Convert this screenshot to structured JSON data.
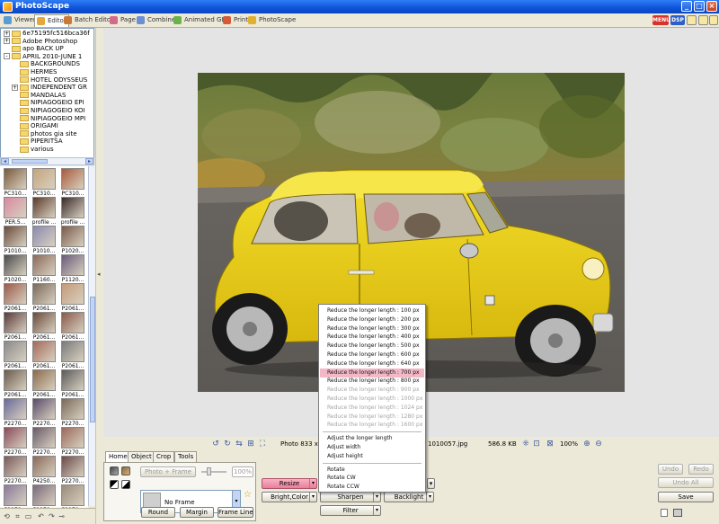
{
  "window": {
    "title": "PhotoScape",
    "controls": [
      "_",
      "□",
      "×"
    ]
  },
  "tabs": [
    {
      "label": "Viewer",
      "color": "#5a9bd4"
    },
    {
      "label": "Editor",
      "color": "#e3a83b"
    },
    {
      "label": "Batch Editor",
      "color": "#c97a3a"
    },
    {
      "label": "Page",
      "color": "#d46a8b"
    },
    {
      "label": "Combine",
      "color": "#6a8fd4"
    },
    {
      "label": "Animated GIF",
      "color": "#6ab34a"
    },
    {
      "label": "Print",
      "color": "#d45a3a"
    },
    {
      "label": "PhotoScape",
      "color": "#e0b030"
    }
  ],
  "toolbar_right": {
    "menu_label": "MENU",
    "menu_color": "#d9322a",
    "dsp_label": "DSP",
    "dsp_color": "#2d5fc9"
  },
  "tree": {
    "items": [
      {
        "label": "6e75195fc516bca36f",
        "indent": 0,
        "expand": "+"
      },
      {
        "label": "Adobe Photoshop",
        "indent": 0,
        "expand": "+"
      },
      {
        "label": "apo BACK UP",
        "indent": 0,
        "expand": ""
      },
      {
        "label": "APRIL 2010-JUNE 1",
        "indent": 0,
        "expand": "-"
      },
      {
        "label": "BACKGROUNDS",
        "indent": 1,
        "expand": ""
      },
      {
        "label": "HERMES",
        "indent": 1,
        "expand": ""
      },
      {
        "label": "HOTEL ODYSSEUS",
        "indent": 1,
        "expand": ""
      },
      {
        "label": "INDEPENDENT GR",
        "indent": 1,
        "expand": "+"
      },
      {
        "label": "MANDALAS",
        "indent": 1,
        "expand": ""
      },
      {
        "label": "NIPIAGOGEIO EPI",
        "indent": 1,
        "expand": ""
      },
      {
        "label": "NIPIAGOGEIO KOI",
        "indent": 1,
        "expand": ""
      },
      {
        "label": "NIPIAGOGEIO MPI",
        "indent": 1,
        "expand": ""
      },
      {
        "label": "ORIGAMI",
        "indent": 1,
        "expand": ""
      },
      {
        "label": "photos gia site",
        "indent": 1,
        "expand": ""
      },
      {
        "label": "PIPERITSA",
        "indent": 1,
        "expand": ""
      },
      {
        "label": "various",
        "indent": 1,
        "expand": ""
      }
    ]
  },
  "thumbnails": [
    {
      "label": "PC310...",
      "color": "#7a5a3a"
    },
    {
      "label": "PC310...",
      "color": "#c4a47a"
    },
    {
      "label": "PC310...",
      "color": "#a85a3a"
    },
    {
      "label": "PER.5...",
      "color": "#d88aa0"
    },
    {
      "label": "profile ...",
      "color": "#5a3a2a"
    },
    {
      "label": "profile ...",
      "color": "#3a2a2a"
    },
    {
      "label": "P1010...",
      "color": "#6a4a3a"
    },
    {
      "label": "P1010...",
      "color": "#8a8ab0"
    },
    {
      "label": "P1020...",
      "color": "#7a5a4a"
    },
    {
      "label": "P1020...",
      "color": "#4a4a4a"
    },
    {
      "label": "P1160...",
      "color": "#8a6a5a"
    },
    {
      "label": "P1120...",
      "color": "#6a5a7a"
    },
    {
      "label": "P2061...",
      "color": "#9a5a4a"
    },
    {
      "label": "P2061...",
      "color": "#7a6a5a"
    },
    {
      "label": "P2061...",
      "color": "#c49a7a"
    },
    {
      "label": "P2061...",
      "color": "#5a3a3a"
    },
    {
      "label": "P2061...",
      "color": "#6a4a3a"
    },
    {
      "label": "P2061...",
      "color": "#8a5a4a"
    },
    {
      "label": "P2061...",
      "color": "#8a8a8a"
    },
    {
      "label": "P2061...",
      "color": "#a46a5a"
    },
    {
      "label": "P2061...",
      "color": "#7a7a7a"
    },
    {
      "label": "P2061...",
      "color": "#6a5a4a"
    },
    {
      "label": "P2061...",
      "color": "#8a6a4a"
    },
    {
      "label": "P2061...",
      "color": "#5a5a5a"
    },
    {
      "label": "P2270...",
      "color": "#6a6a9a"
    },
    {
      "label": "P2270...",
      "color": "#5a4a6a"
    },
    {
      "label": "P2270...",
      "color": "#7a6a5a"
    },
    {
      "label": "P2270...",
      "color": "#8a4a5a"
    },
    {
      "label": "P2270...",
      "color": "#6a5a6a"
    },
    {
      "label": "P2270...",
      "color": "#9a6a5a"
    },
    {
      "label": "P2270...",
      "color": "#7a5a5a"
    },
    {
      "label": "P4250...",
      "color": "#8a6a5a"
    },
    {
      "label": "P2270...",
      "color": "#6a4a4a"
    },
    {
      "label": "P2270...",
      "color": "#8a7a9a"
    },
    {
      "label": "P2270...",
      "color": "#7a6a7a"
    },
    {
      "label": "P2270...",
      "color": "#9a8a7a"
    }
  ],
  "status": {
    "photo_info": "Photo 833 x",
    "filename": "1010057.jpg",
    "filesize": "586.8 KB",
    "zoom": "100%"
  },
  "panel": {
    "tabs": [
      "Home",
      "Object",
      "Crop",
      "Tools"
    ],
    "photo_frame_label": "Photo + Frame",
    "frame_percent": "100%",
    "frame_name": "No Frame",
    "round_label": "Round",
    "margin_label": "Margin",
    "frame_line_label": "Frame Line",
    "resize_label": "Resize",
    "bright_color_label": "Bright,Color",
    "sharpen_label": "Sharpen",
    "backlight_label": "Backlight",
    "filter_label": "Filter",
    "undo_label": "Undo",
    "redo_label": "Redo",
    "undo_all_label": "Undo All",
    "save_label": "Save"
  },
  "resize_menu": {
    "items": [
      {
        "label": "Reduce the longer length : 100 px",
        "state": "normal"
      },
      {
        "label": "Reduce the longer length : 200 px",
        "state": "normal"
      },
      {
        "label": "Reduce the longer length : 300 px",
        "state": "normal"
      },
      {
        "label": "Reduce the longer length : 400 px",
        "state": "normal"
      },
      {
        "label": "Reduce the longer length : 500 px",
        "state": "normal"
      },
      {
        "label": "Reduce the longer length : 600 px",
        "state": "normal"
      },
      {
        "label": "Reduce the longer length : 640 px",
        "state": "normal"
      },
      {
        "label": "Reduce the longer length : 700 px",
        "state": "highlighted"
      },
      {
        "label": "Reduce the longer length : 800 px",
        "state": "normal"
      },
      {
        "label": "Reduce the longer length : 900 px",
        "state": "disabled"
      },
      {
        "label": "Reduce the longer length : 1000 px",
        "state": "disabled"
      },
      {
        "label": "Reduce the longer length : 1024 px",
        "state": "disabled"
      },
      {
        "label": "Reduce the longer length : 1280 px",
        "state": "disabled"
      },
      {
        "label": "Reduce the longer length : 1600 px",
        "state": "disabled"
      }
    ],
    "adjust_items": [
      "Adjust the longer length",
      "Adjust width",
      "Adjust height"
    ],
    "rotate_items": [
      "Rotate",
      "Rotate CW",
      "Rotate CCW"
    ]
  }
}
